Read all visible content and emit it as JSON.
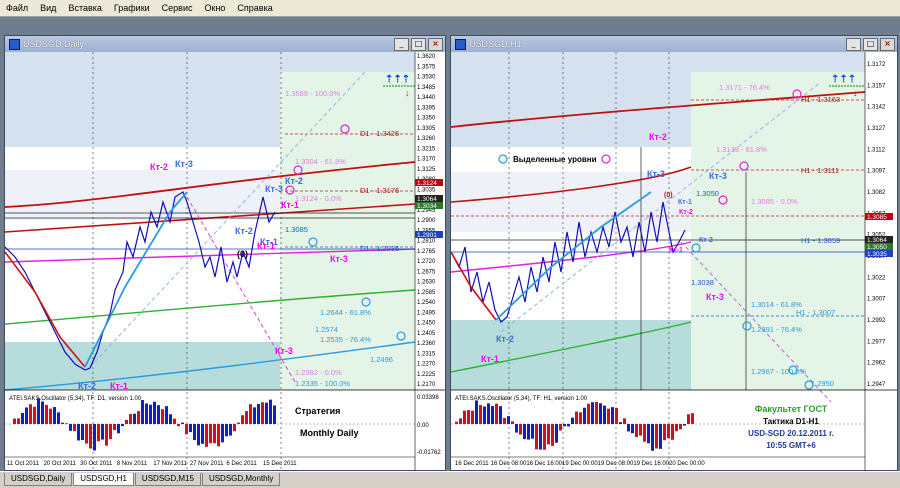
{
  "menu": [
    "Файл",
    "Вид",
    "Вставка",
    "Графики",
    "Сервис",
    "Окно",
    "Справка"
  ],
  "windows": {
    "daily": {
      "title": "USDSGD,Daily",
      "osc_label": "ATEI.SAKS.Oscillator (5,34), TF: D1, version 1.00",
      "osc_ticks": [
        "0.03398",
        "0.00",
        "-0.01762"
      ],
      "price_ticks": [
        "1.3620",
        "1.3575",
        "1.3530",
        "1.3485",
        "1.3440",
        "1.3395",
        "1.3350",
        "1.3305",
        "1.3260",
        "1.3215",
        "1.3170",
        "1.3125",
        "1.3080",
        "1.3035",
        "1.2990",
        "1.2945",
        "1.2900",
        "1.2855",
        "1.2810",
        "1.2765",
        "1.2720",
        "1.2675",
        "1.2630",
        "1.2585",
        "1.2540",
        "1.2495",
        "1.2450",
        "1.2405",
        "1.2360",
        "1.2315",
        "1.2270",
        "1.2225",
        "1.2170"
      ],
      "price_badges": [
        "1.3124",
        "1.3064",
        "1.3034",
        "1.2901"
      ],
      "date_ticks": [
        "11 Oct 2011",
        "20 Oct 2011",
        "30 Oct 2011",
        "8 Nov 2011",
        "17 Nov 2011",
        "27 Nov 2011",
        "6 Dec 2011",
        "15 Dec 2011"
      ],
      "level_labels": [
        "1.3589 - 100.0%",
        "D1 - 1.3426",
        "1.3304 - 61.8%",
        "D1 - 1.3176",
        "1.3124 - 0.0%",
        "1.3085",
        "D1 - 1.2936",
        "1.2644 - 61.8%",
        "1.2574",
        "1.2535 - 76.4%",
        "1.2382 - 0.0%",
        "1.2335 - 100.0%",
        "1.2496"
      ],
      "annotations": [
        "Кт-2",
        "Кт-3",
        "Кт-1",
        "Кт-2",
        "Кт-1",
        "Кт-3",
        "Кт-1",
        "Кт-2",
        "(0)",
        "Кт-3",
        "Кт-3",
        "Кт-2",
        "Кт-1"
      ],
      "text_strategy": "Стратегия",
      "text_monthly": "Monthly Daily"
    },
    "h1": {
      "title": "USDSGD,H1",
      "osc_label": "ATEI.SAKS.Oscillator (5,34), TF: H1, version 1.00",
      "price_ticks": [
        "1.3172",
        "1.3157",
        "1.3142",
        "1.3127",
        "1.3112",
        "1.3097",
        "1.3082",
        "1.3067",
        "1.3052",
        "1.3037",
        "1.3022",
        "1.3007",
        "1.2992",
        "1.2977",
        "1.2962",
        "1.2947"
      ],
      "price_badges": [
        "1.3085",
        "1.3064",
        "1.3050",
        "1.3035"
      ],
      "date_ticks": [
        "16 Dec 2011",
        "16 Dec 08:00",
        "16 Dec 16:00",
        "19 Dec 00:00",
        "19 Dec 08:00",
        "19 Dec 16:00",
        "20 Dec 00:00"
      ],
      "level_labels": [
        "1.3171 - 76.4%",
        "H1 - 1.3163",
        "1.3133 - 61.8%",
        "H1 - 1.3111",
        "1.3085 - 0.0%",
        "1.3050",
        "H1 - 1.3059",
        "1.3038",
        "1.3014 - 61.8%",
        "H1 - 1.3007",
        "1.2991 - 76.4%",
        "1.2967 - 100.0%",
        "1.2950"
      ],
      "annotations": [
        "Кт-2",
        "Кт-3",
        "Кт-3",
        "(0)",
        "Кт-1",
        "Кт-2",
        "Кт-1",
        "Кт-2",
        "Кт-3",
        "Кт-2",
        "Кт-1"
      ],
      "legend_text": "Выделенные уровни",
      "info": [
        "Факультет ГОСТ",
        "Тактика D1-H1",
        "USD-SGD  20.12.2011 г.",
        "10:55  GMT+6"
      ]
    }
  },
  "tabs": [
    "USDSGD,Daily",
    "USDSGD,H1",
    "USDSGD,M15",
    "USDSGD,Monthly"
  ],
  "active_tab": 1,
  "colors": {
    "workspace": "#6f7d8c",
    "sky": "#d6e1ef",
    "teal": "#b6dcdc",
    "pink_label": "#ff00ff",
    "blue_label": "#3a6de0"
  }
}
